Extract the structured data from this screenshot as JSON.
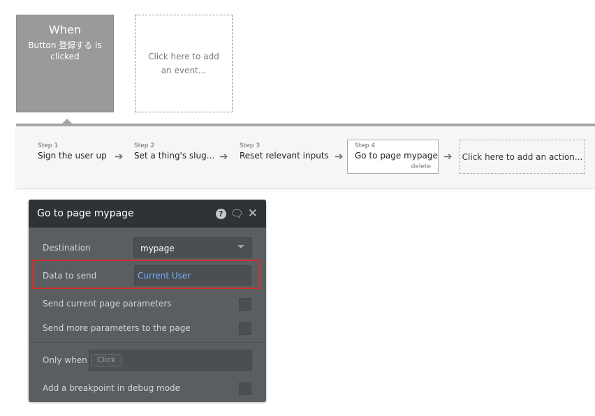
{
  "event": {
    "title": "When",
    "description": "Button 登録する is clicked",
    "add_event": "Click here to add an event..."
  },
  "steps": [
    {
      "num": "Step 1",
      "label": "Sign the user up"
    },
    {
      "num": "Step 2",
      "label": "Set a thing's slug..."
    },
    {
      "num": "Step 3",
      "label": "Reset relevant inputs"
    },
    {
      "num": "Step 4",
      "label": "Go to page mypage",
      "delete": "delete"
    }
  ],
  "add_action": "Click here to add an action...",
  "panel": {
    "title": "Go to page mypage",
    "destination_label": "Destination",
    "destination_value": "mypage",
    "data_label": "Data to send",
    "data_value": "Current User",
    "send_current_params": "Send current page parameters",
    "send_more_params": "Send more parameters to the page",
    "only_when_label": "Only when",
    "only_when_placeholder": "Click",
    "breakpoint_label": "Add a breakpoint in debug mode"
  },
  "colors": {
    "accent_highlight": "#d32f2f",
    "link_blue": "#6fb1ff",
    "panel_bg": "#5a5e60",
    "header_bg": "#2f3335"
  }
}
